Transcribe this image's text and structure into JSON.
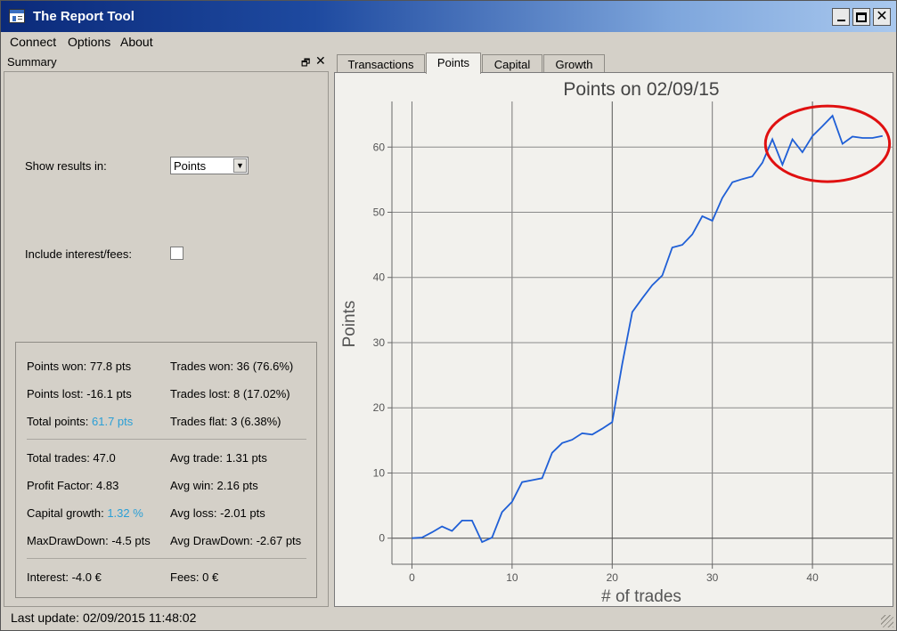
{
  "window": {
    "title": "The Report Tool",
    "icon": "report-tool-icon"
  },
  "menu": [
    "Connect",
    "Options",
    "About"
  ],
  "dock": {
    "title": "Summary"
  },
  "controls": {
    "show_results_label": "Show results in:",
    "show_results_value": "Points",
    "interest_label": "Include interest/fees:",
    "interest_checked": false
  },
  "stats": {
    "points_won": "Points won: 77.8 pts",
    "trades_won": "Trades won: 36 (76.6%)",
    "points_lost": "Points lost: -16.1 pts",
    "trades_lost": "Trades lost: 8 (17.02%)",
    "total_points_label": "Total points: ",
    "total_points_value": "61.7 pts",
    "trades_flat": "Trades flat: 3 (6.38%)",
    "total_trades": "Total trades: 47.0",
    "avg_trade": "Avg trade: 1.31 pts",
    "profit_factor": "Profit Factor: 4.83",
    "avg_win": "Avg win: 2.16 pts",
    "capital_growth_label": "Capital growth: ",
    "capital_growth_value": "1.32 %",
    "avg_loss": "Avg loss: -2.01 pts",
    "max_drawdown": "MaxDrawDown: -4.5 pts",
    "avg_drawdown": "Avg DrawDown: -2.67 pts",
    "interest": "Interest: -4.0 €",
    "fees": "Fees: 0 €",
    "accent_color": "#2a9fd6"
  },
  "tabs": [
    {
      "label": "Transactions",
      "active": false
    },
    {
      "label": "Points",
      "active": true
    },
    {
      "label": "Capital",
      "active": false
    },
    {
      "label": "Growth",
      "active": false
    }
  ],
  "status": {
    "last_update": "Last update: 02/09/2015 11:48:02"
  },
  "chart_data": {
    "type": "line",
    "title": "Points on 02/09/15",
    "xlabel": "# of trades",
    "ylabel": "Points",
    "xlim": [
      -2,
      48
    ],
    "ylim": [
      -4,
      67
    ],
    "xticks": [
      0,
      10,
      20,
      30,
      40
    ],
    "yticks": [
      0,
      10,
      20,
      30,
      40,
      50,
      60
    ],
    "grid": "vertical-and-horizontal",
    "line_color": "#1f5fd6",
    "annotation": {
      "type": "ellipse",
      "color": "#e01010",
      "center": [
        41.5,
        60.5
      ],
      "radii": [
        6.2,
        5.8
      ]
    },
    "x": [
      0,
      1,
      2,
      3,
      4,
      5,
      6,
      7,
      8,
      9,
      10,
      11,
      12,
      13,
      14,
      15,
      16,
      17,
      18,
      19,
      20,
      21,
      22,
      23,
      24,
      25,
      26,
      27,
      28,
      29,
      30,
      31,
      32,
      33,
      34,
      35,
      36,
      37,
      38,
      39,
      40,
      41,
      42,
      43,
      44,
      45,
      46,
      47
    ],
    "y": [
      0.0,
      0.1,
      0.9,
      1.8,
      1.1,
      2.7,
      2.7,
      -0.6,
      0.1,
      4.0,
      5.6,
      8.6,
      8.9,
      9.2,
      13.1,
      14.6,
      15.1,
      16.1,
      15.9,
      16.8,
      17.8,
      26.7,
      34.7,
      36.8,
      38.8,
      40.3,
      44.6,
      45.0,
      46.6,
      49.4,
      48.7,
      52.2,
      54.6,
      55.1,
      55.5,
      57.6,
      61.2,
      57.3,
      61.2,
      59.2,
      61.7,
      63.2,
      64.8,
      60.5,
      61.6,
      61.4,
      61.4,
      61.7
    ]
  }
}
